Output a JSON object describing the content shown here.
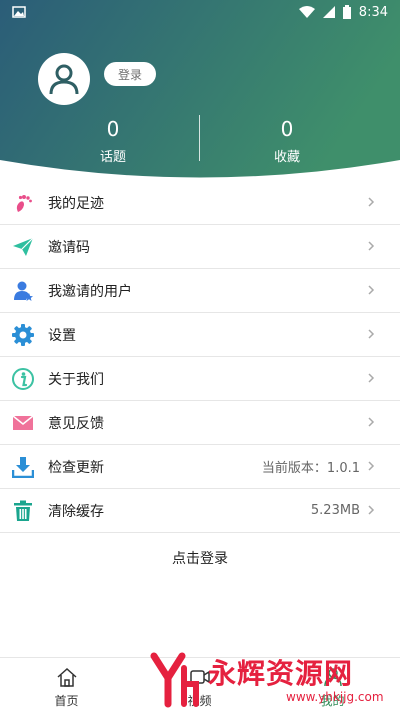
{
  "status": {
    "time": "8:34"
  },
  "profile": {
    "login_label": "登录"
  },
  "stats": [
    {
      "value": "0",
      "label": "话题"
    },
    {
      "value": "0",
      "label": "收藏"
    }
  ],
  "menu": [
    {
      "label": "我的足迹",
      "icon": "footprint-icon",
      "value": ""
    },
    {
      "label": "邀请码",
      "icon": "paper-plane-icon",
      "value": ""
    },
    {
      "label": "我邀请的用户",
      "icon": "user-star-icon",
      "value": ""
    },
    {
      "label": "设置",
      "icon": "gear-icon",
      "value": ""
    },
    {
      "label": "关于我们",
      "icon": "info-icon",
      "value": ""
    },
    {
      "label": "意见反馈",
      "icon": "envelope-icon",
      "value": ""
    },
    {
      "label": "检查更新",
      "icon": "download-icon",
      "value": "当前版本：1.0.1"
    },
    {
      "label": "清除缓存",
      "icon": "trash-icon",
      "value": "5.23MB"
    }
  ],
  "login_link": "点击登录",
  "tabs": [
    {
      "label": "首页",
      "icon": "home-icon",
      "active": false
    },
    {
      "label": "视频",
      "icon": "video-icon",
      "active": false
    },
    {
      "label": "我的",
      "icon": "profile-icon",
      "active": true
    }
  ],
  "watermark": {
    "brand": "永辉资源网",
    "url": "www.yhkjjg.com"
  },
  "colors": {
    "header_start": "#2b5d78",
    "header_end": "#3f8f6b",
    "active_tab": "#2e8b57"
  }
}
